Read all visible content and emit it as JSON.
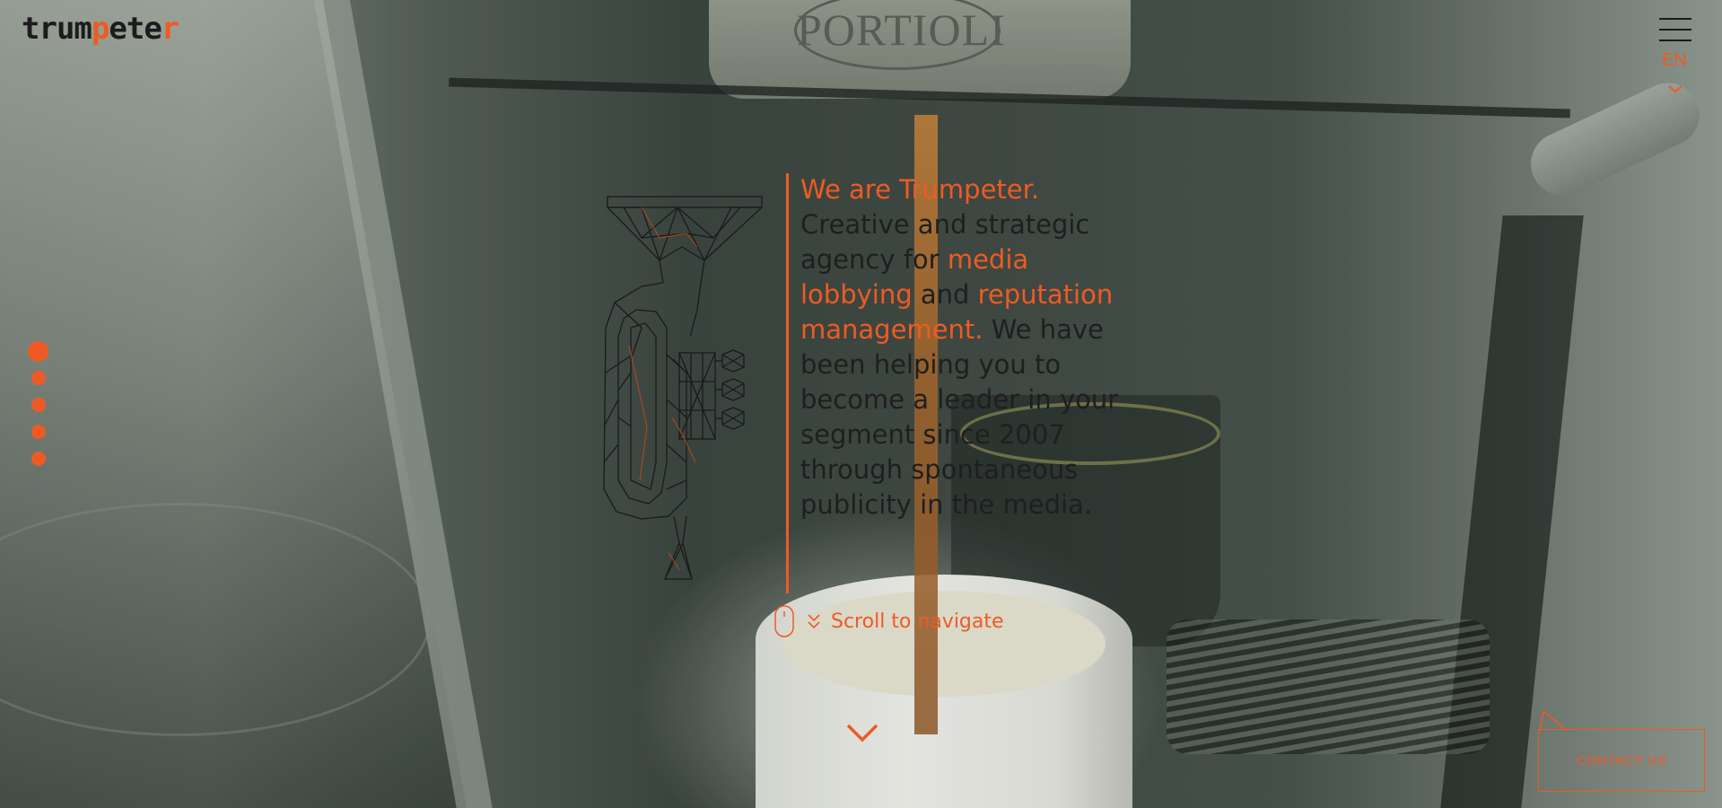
{
  "brand": {
    "logo_parts": [
      "trum",
      "p",
      "ete",
      "r"
    ],
    "accent_color": "#ef5a24"
  },
  "header": {
    "menu_icon": "hamburger-menu-icon",
    "language": "EN",
    "language_icon": "chevron-down-icon"
  },
  "background": {
    "machine_brand_text": "PORTIOLI"
  },
  "side_nav": {
    "dots": 5,
    "active_index": 0
  },
  "intro": {
    "segments": [
      {
        "text": "We are Trumpeter.",
        "accent": true
      },
      {
        "text": " Creative and strategic agency for ",
        "accent": false
      },
      {
        "text": "media lobbying",
        "accent": true
      },
      {
        "text": " and ",
        "accent": false
      },
      {
        "text": "reputation management.",
        "accent": true
      },
      {
        "text": " We have been helping you to become a leader in your segment since 2007 through spontaneous publicity in the media.",
        "accent": false
      }
    ]
  },
  "scroll_hint": {
    "label": "Scroll to navigate",
    "icons": [
      "mouse-icon",
      "chevron-double-down-icon"
    ]
  },
  "down_arrow_icon": "chevron-down-icon",
  "contact": {
    "label": "CONTACT US"
  }
}
